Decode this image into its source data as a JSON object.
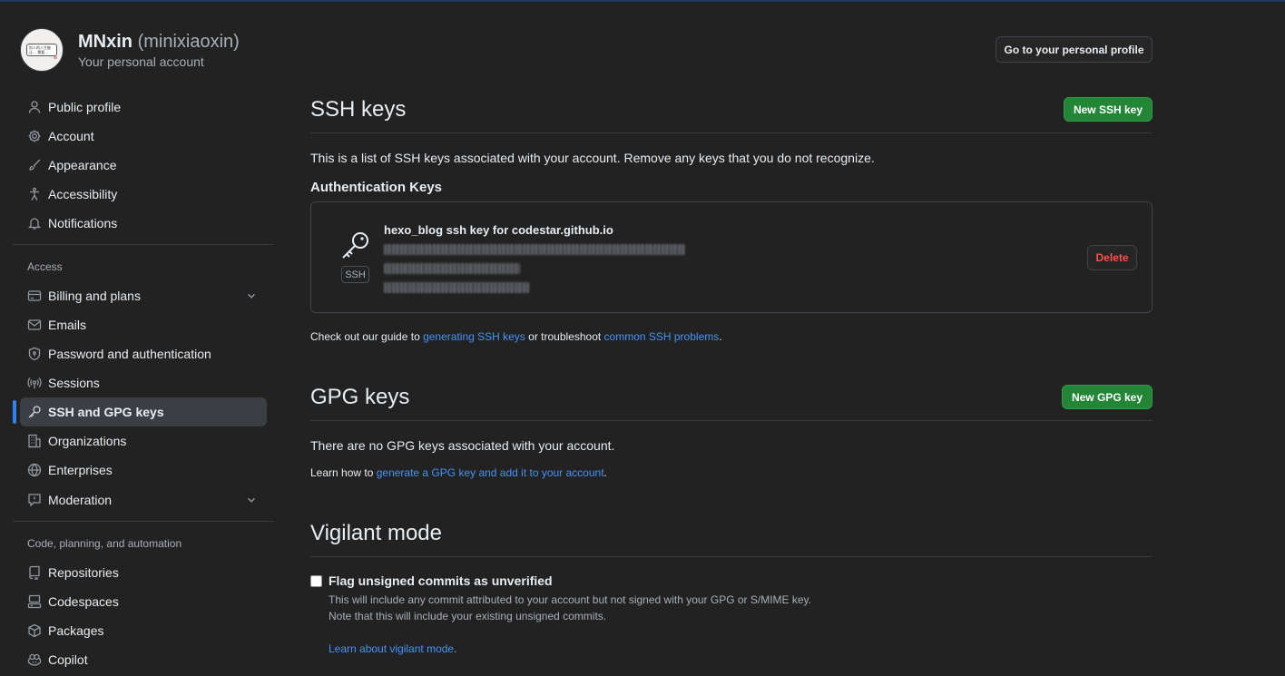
{
  "header": {
    "display_name": "MNxin",
    "login": "(minixiaoxin)",
    "subtitle": "Your personal account",
    "avatar_text": "别人的人生能让… 需要…",
    "profile_button": "Go to your personal profile"
  },
  "sidebar": {
    "items_top": [
      {
        "label": "Public profile",
        "icon": "person-icon"
      },
      {
        "label": "Account",
        "icon": "gear-icon"
      },
      {
        "label": "Appearance",
        "icon": "paintbrush-icon"
      },
      {
        "label": "Accessibility",
        "icon": "accessibility-icon"
      },
      {
        "label": "Notifications",
        "icon": "bell-icon"
      }
    ],
    "group_access": "Access",
    "items_access": [
      {
        "label": "Billing and plans",
        "icon": "credit-card-icon"
      },
      {
        "label": "Emails",
        "icon": "mail-icon"
      },
      {
        "label": "Password and authentication",
        "icon": "shield-lock-icon"
      },
      {
        "label": "Sessions",
        "icon": "broadcast-icon"
      },
      {
        "label": "SSH and GPG keys",
        "icon": "key-icon"
      },
      {
        "label": "Organizations",
        "icon": "organization-icon"
      },
      {
        "label": "Enterprises",
        "icon": "globe-icon"
      },
      {
        "label": "Moderation",
        "icon": "report-icon"
      }
    ],
    "group_code": "Code, planning, and automation",
    "items_code": [
      {
        "label": "Repositories",
        "icon": "repo-icon"
      },
      {
        "label": "Codespaces",
        "icon": "codespaces-icon"
      },
      {
        "label": "Packages",
        "icon": "package-icon"
      },
      {
        "label": "Copilot",
        "icon": "copilot-icon"
      }
    ]
  },
  "ssh": {
    "title": "SSH keys",
    "new_button": "New SSH key",
    "description": "This is a list of SSH keys associated with your account. Remove any keys that you do not recognize.",
    "auth_heading": "Authentication Keys",
    "key": {
      "title": "hexo_blog ssh key for codestar.github.io",
      "badge": "SSH",
      "delete_label": "Delete"
    },
    "guide": {
      "prefix": "Check out our guide to ",
      "link1": "generating SSH keys",
      "middle": " or troubleshoot ",
      "link2": "common SSH problems",
      "suffix": "."
    }
  },
  "gpg": {
    "title": "GPG keys",
    "new_button": "New GPG key",
    "empty_text": "There are no GPG keys associated with your account.",
    "learn": {
      "prefix": "Learn how to ",
      "link": "generate a GPG key and add it to your account",
      "suffix": "."
    }
  },
  "vigilant": {
    "title": "Vigilant mode",
    "checkbox_label": "Flag unsigned commits as unverified",
    "checked": false,
    "note1": "This will include any commit attributed to your account but not signed with your GPG or S/MIME key.",
    "note2": "Note that this will include your existing unsigned commits.",
    "learn_link": "Learn about vigilant mode",
    "learn_suffix": "."
  },
  "colors": {
    "accent": "#2f81f7",
    "link": "#4493f8",
    "green": "#238636",
    "danger": "#f85149",
    "background": "#222222"
  }
}
